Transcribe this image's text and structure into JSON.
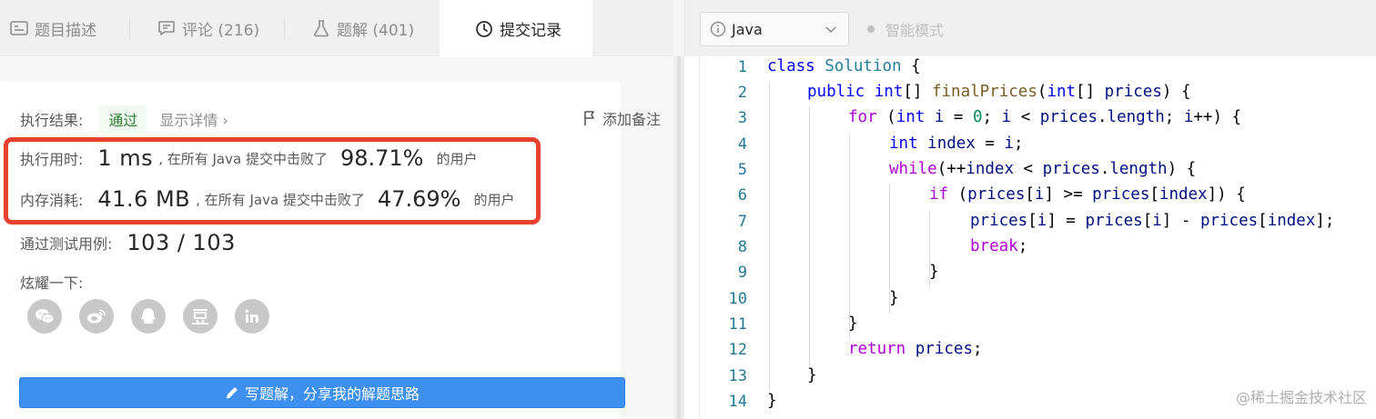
{
  "tabs": [
    {
      "label": "题目描述",
      "icon": "description-icon"
    },
    {
      "label": "评论 (216)",
      "icon": "comment-icon"
    },
    {
      "label": "题解 (401)",
      "icon": "flask-icon"
    },
    {
      "label": "提交记录",
      "icon": "clock-icon",
      "active": true
    }
  ],
  "result": {
    "label": "执行结果:",
    "status": "通过",
    "details": "显示详情 ›",
    "add_note": "添加备注"
  },
  "runtime": {
    "label": "执行用时:",
    "value": "1 ms",
    "mid": ", 在所有 Java 提交中击败了",
    "percent": "98.71%",
    "suffix": "的用户"
  },
  "memory": {
    "label": "内存消耗:",
    "value": "41.6 MB",
    "mid": ", 在所有 Java 提交中击败了",
    "percent": "47.69%",
    "suffix": "的用户"
  },
  "testcases": {
    "label": "通过测试用例:",
    "value": "103 / 103"
  },
  "share": {
    "label": "炫耀一下:",
    "icons": [
      "wechat-icon",
      "weibo-icon",
      "qq-icon",
      "douban-icon",
      "linkedin-icon"
    ]
  },
  "write_button": "写题解，分享我的解题思路",
  "editor": {
    "language": "Java",
    "smart_mode": "智能模式",
    "line_numbers": [
      "1",
      "2",
      "3",
      "4",
      "5",
      "6",
      "7",
      "8",
      "9",
      "10",
      "11",
      "12",
      "13",
      "14"
    ]
  },
  "watermark": "@稀土掘金技术社区",
  "colors": {
    "accent_blue": "#3d8ff0",
    "highlight_red": "#e8412f",
    "pass_green": "#2e7d32"
  }
}
